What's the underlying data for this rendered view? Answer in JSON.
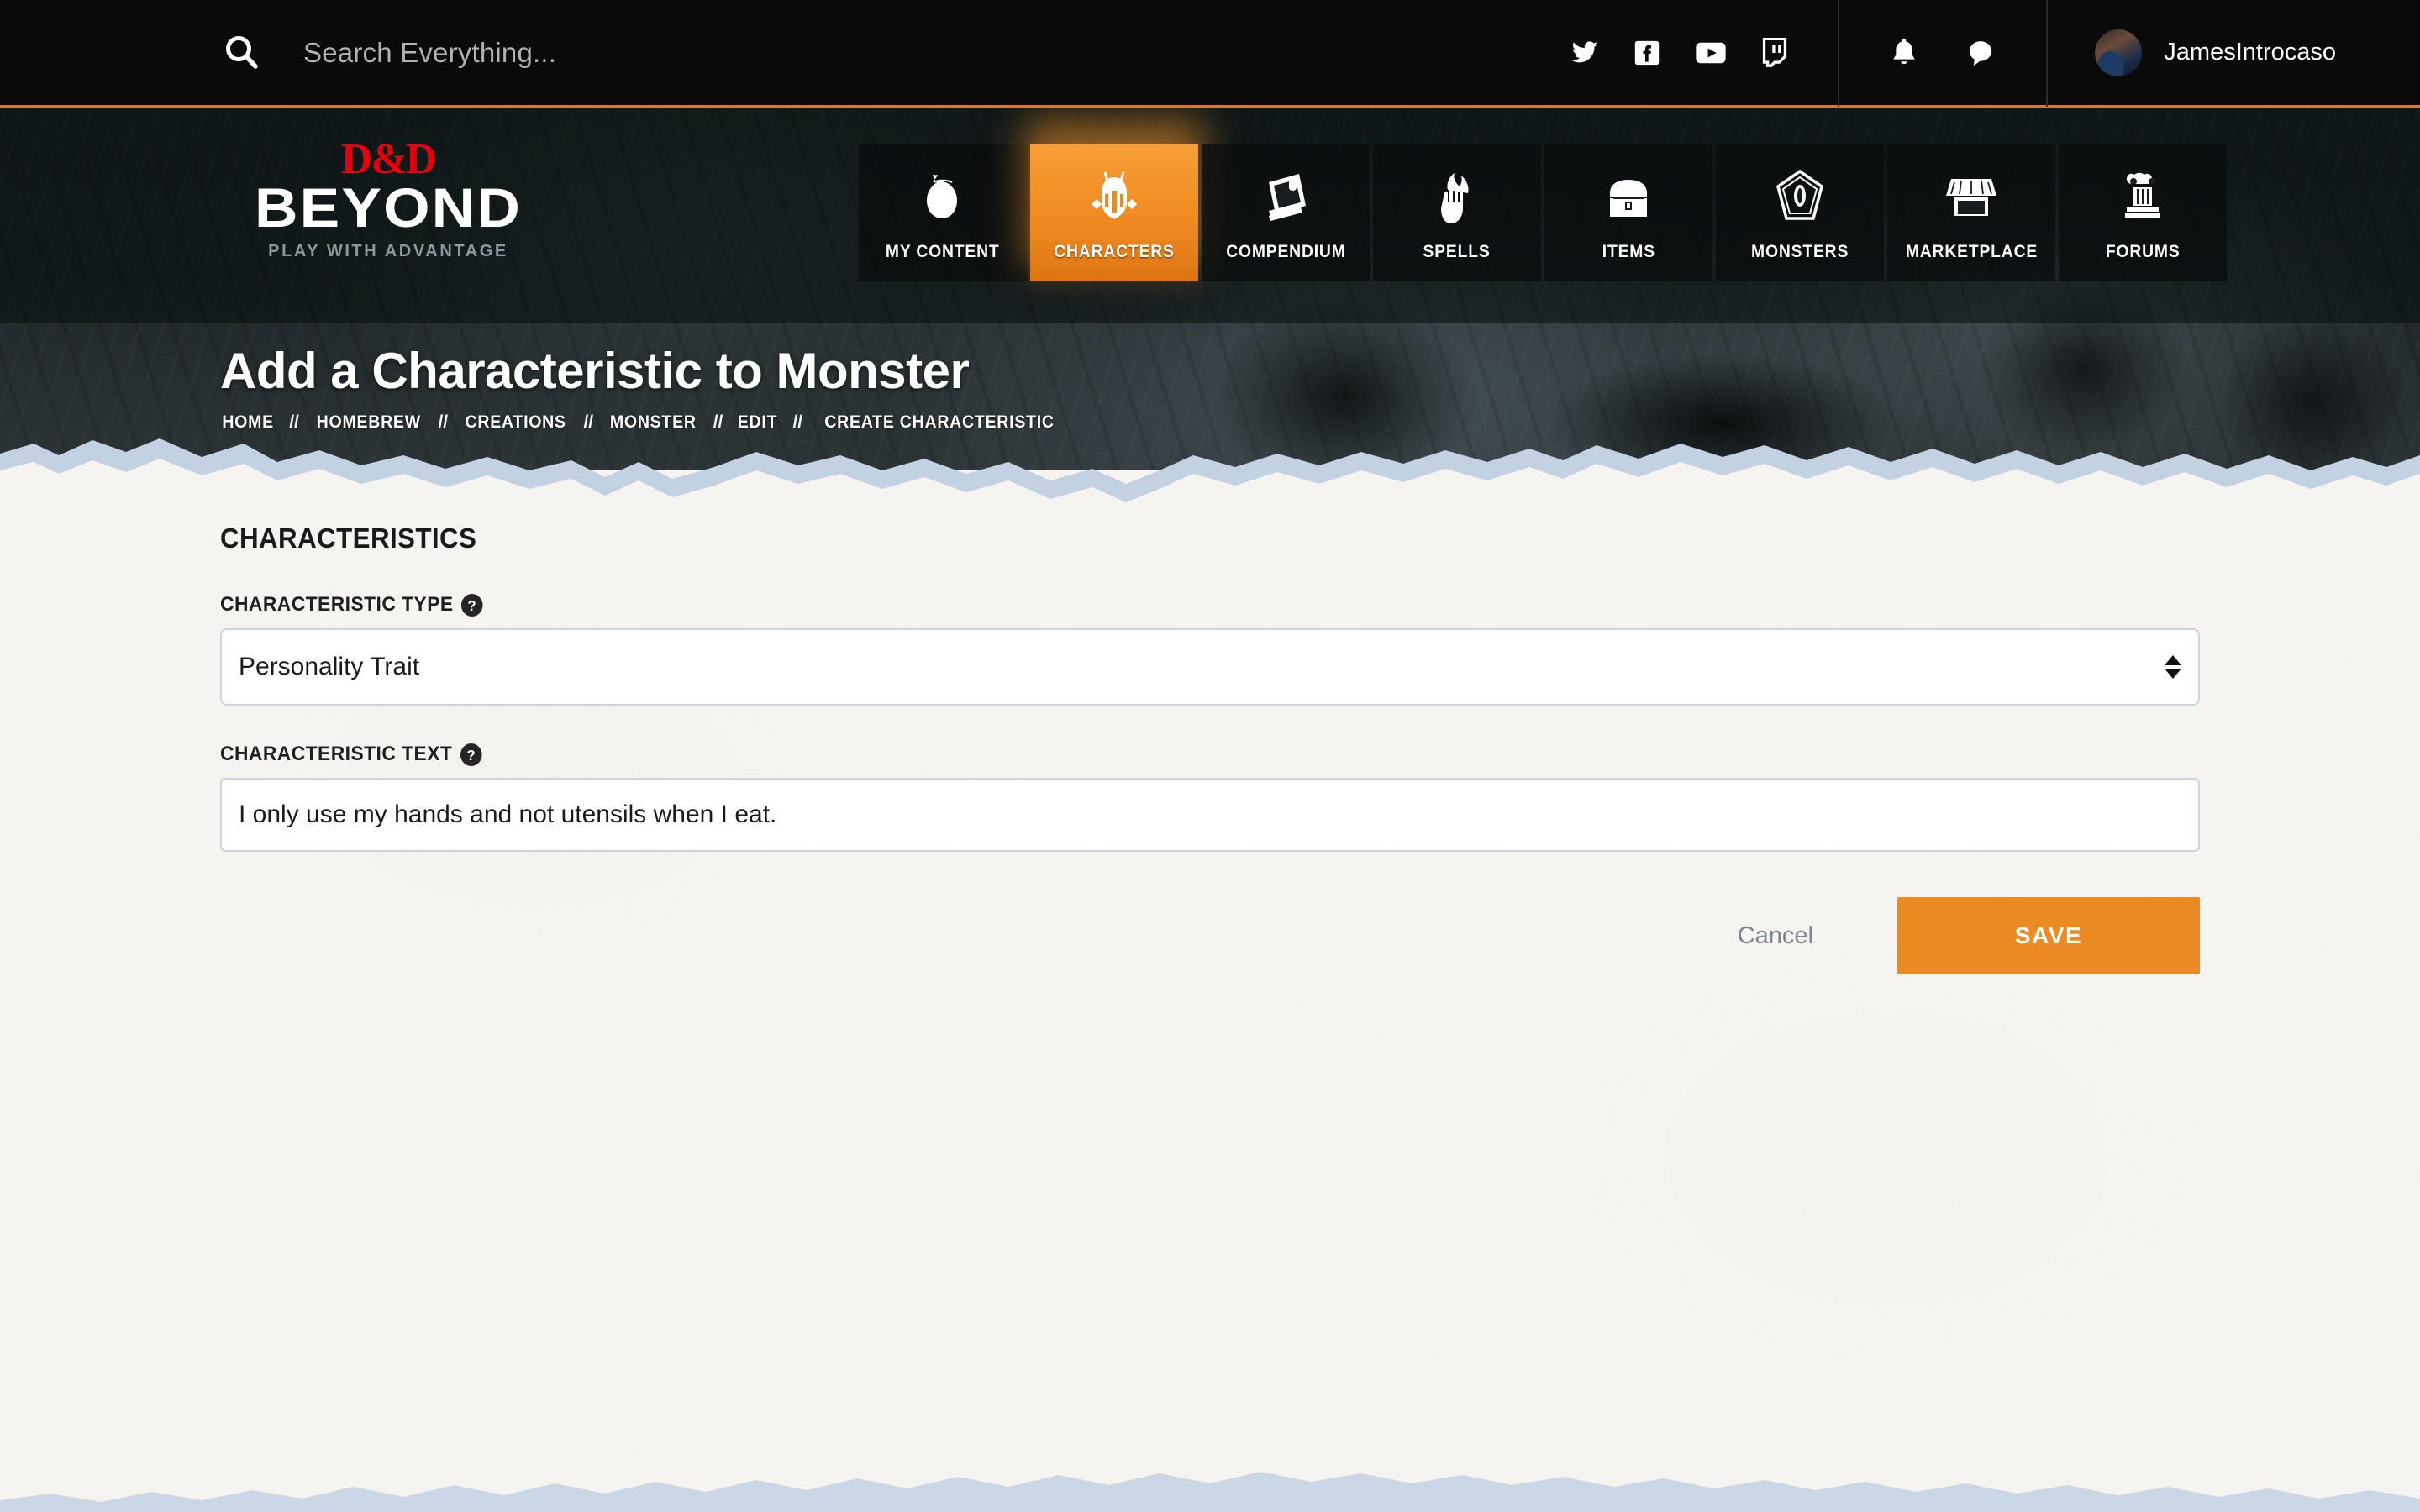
{
  "topbar": {
    "search_placeholder": "Search Everything...",
    "search_value": "",
    "social": [
      {
        "name": "twitter-icon",
        "label": "Twitter"
      },
      {
        "name": "facebook-icon",
        "label": "Facebook"
      },
      {
        "name": "youtube-icon",
        "label": "YouTube"
      },
      {
        "name": "twitch-icon",
        "label": "Twitch"
      }
    ],
    "alerts": [
      {
        "name": "bell-icon",
        "label": "Notifications"
      },
      {
        "name": "chat-icon",
        "label": "Messages"
      }
    ],
    "username": "JamesIntrocaso",
    "accent_color": "#e2761c"
  },
  "logo": {
    "brand": "D&D",
    "name": "BEYOND",
    "tagline": "PLAY WITH ADVANTAGE",
    "brand_color": "#e3000f"
  },
  "nav": {
    "active_color": "#ef8b22",
    "items": [
      {
        "label": "MY CONTENT",
        "icon": "bag-icon",
        "active": false
      },
      {
        "label": "CHARACTERS",
        "icon": "helmet-icon",
        "active": true
      },
      {
        "label": "COMPENDIUM",
        "icon": "book-icon",
        "active": false
      },
      {
        "label": "SPELLS",
        "icon": "flame-hand-icon",
        "active": false
      },
      {
        "label": "ITEMS",
        "icon": "chest-icon",
        "active": false
      },
      {
        "label": "MONSTERS",
        "icon": "eye-shield-icon",
        "active": false
      },
      {
        "label": "MARKETPLACE",
        "icon": "shop-icon",
        "active": false
      },
      {
        "label": "FORUMS",
        "icon": "column-icon",
        "active": false
      }
    ]
  },
  "hero": {
    "title": "Add a Characteristic to Monster",
    "breadcrumb": [
      "HOME",
      "HOMEBREW",
      "CREATIONS",
      "MONSTER",
      "EDIT",
      "CREATE CHARACTERISTIC"
    ],
    "breadcrumb_separator": "//"
  },
  "form": {
    "section_title": "CHARACTERISTICS",
    "type_field": {
      "label": "CHARACTERISTIC TYPE",
      "help": "?",
      "value": "Personality Trait"
    },
    "text_field": {
      "label": "CHARACTERISTIC TEXT",
      "help": "?",
      "value": "I only use my hands and not utensils when I eat.",
      "placeholder": ""
    },
    "cancel_label": "Cancel",
    "save_label": "SAVE",
    "save_color": "#ec8b23"
  }
}
